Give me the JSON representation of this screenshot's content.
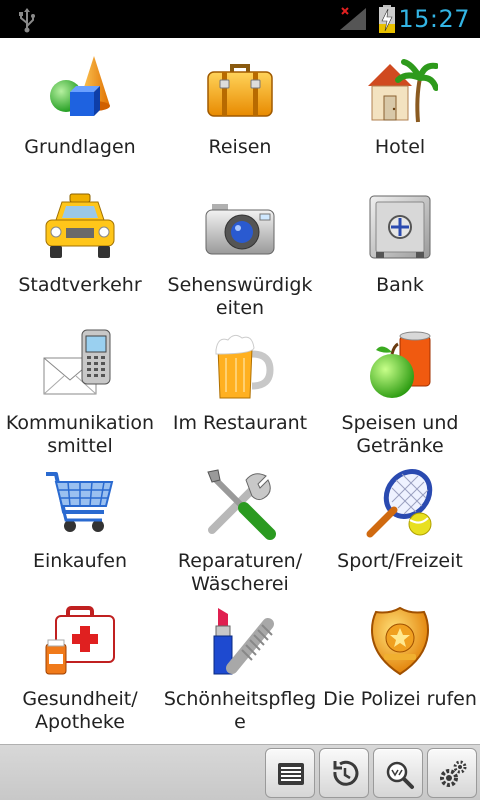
{
  "status_bar": {
    "time": "15:27",
    "icons": [
      "usb-icon",
      "no-signal-icon",
      "battery-charging-icon"
    ],
    "colors": {
      "clock": "#33b5e5",
      "background": "#000000"
    }
  },
  "menu": {
    "items": [
      {
        "label": "Grundlagen",
        "icon": "shapes-icon"
      },
      {
        "label": "Reisen",
        "icon": "suitcase-icon"
      },
      {
        "label": "Hotel",
        "icon": "house-palm-icon"
      },
      {
        "label": "Stadtverkehr",
        "icon": "taxi-icon"
      },
      {
        "label": "Sehenswürdigk\neiten",
        "icon": "camera-icon"
      },
      {
        "label": "Bank",
        "icon": "safe-icon"
      },
      {
        "label": "Kommunikation\nsmittel",
        "icon": "phone-envelope-icon"
      },
      {
        "label": "Im Restaurant",
        "icon": "beer-mug-icon"
      },
      {
        "label": "Speisen und\nGetränke",
        "icon": "apple-can-icon"
      },
      {
        "label": "Einkaufen",
        "icon": "shopping-cart-icon"
      },
      {
        "label": "Reparaturen/\nWäscherei",
        "icon": "tools-icon"
      },
      {
        "label": "Sport/Freizeit",
        "icon": "tennis-icon"
      },
      {
        "label": "Gesundheit/\nApotheke",
        "icon": "first-aid-kit-icon"
      },
      {
        "label": "Schönheitspfleg\ne",
        "icon": "lipstick-comb-icon"
      },
      {
        "label": "Die Polizei rufen",
        "icon": "police-badge-icon"
      }
    ]
  },
  "toolbar": {
    "buttons": [
      {
        "icon": "list-icon"
      },
      {
        "icon": "history-icon"
      },
      {
        "icon": "search-icon"
      },
      {
        "icon": "settings-icon"
      }
    ]
  }
}
